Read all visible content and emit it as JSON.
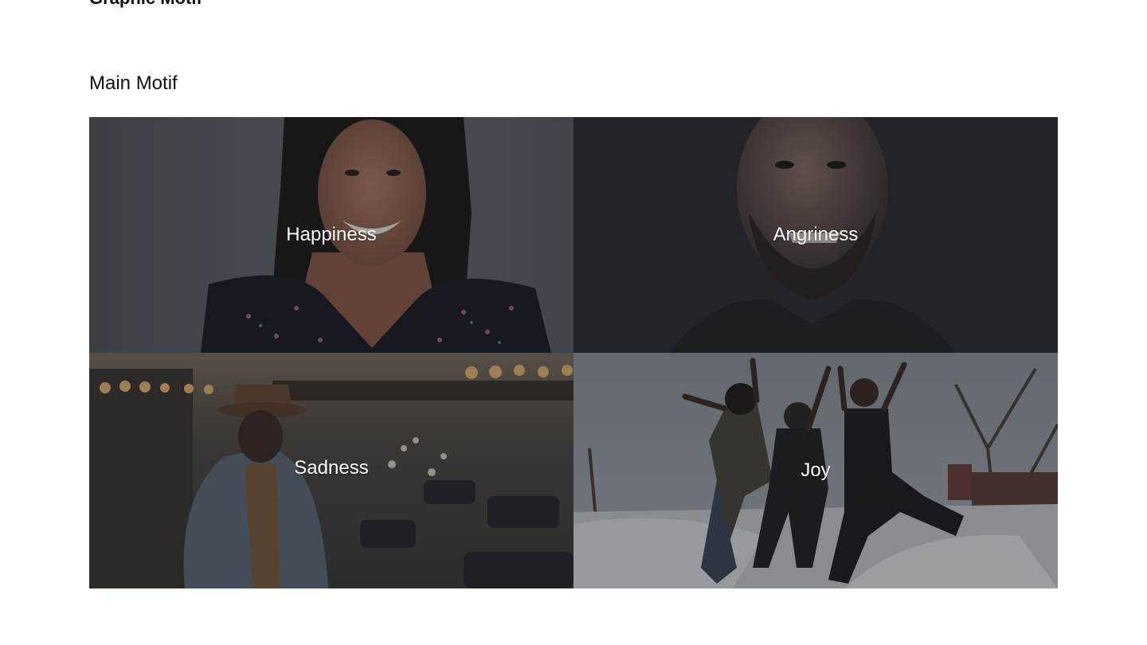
{
  "header": {
    "title": "Graphic Motif"
  },
  "section": {
    "title": "Main Motif"
  },
  "motifs": [
    {
      "label": "Happiness",
      "image": "smiling-woman-photo",
      "tint": "#3a3b42"
    },
    {
      "label": "Angriness",
      "image": "angry-man-photo",
      "tint": "#1d1e23"
    },
    {
      "label": "Sadness",
      "image": "sad-man-city-street-photo",
      "tint": "#3c3a36"
    },
    {
      "label": "Joy",
      "image": "jumping-friends-snow-photo",
      "tint": "#5a5e66"
    }
  ]
}
